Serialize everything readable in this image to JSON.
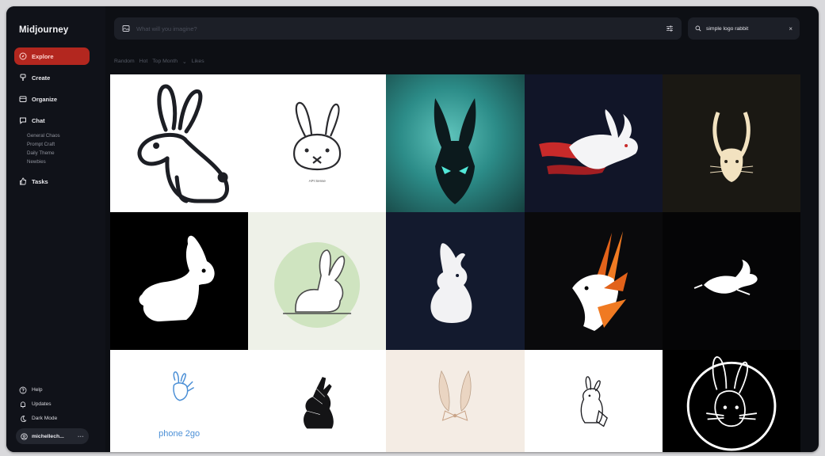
{
  "app": {
    "name": "Midjourney"
  },
  "sidebar": {
    "items": [
      {
        "label": "Explore",
        "icon": "compass-icon",
        "active": true
      },
      {
        "label": "Create",
        "icon": "brush-icon"
      },
      {
        "label": "Organize",
        "icon": "folder-icon"
      },
      {
        "label": "Chat",
        "icon": "chat-icon"
      },
      {
        "label": "Tasks",
        "icon": "thumbs-up-icon"
      }
    ],
    "chat_channels": [
      "General Chaos",
      "Prompt Craft",
      "Daily Theme",
      "Newbies"
    ],
    "bottom": [
      {
        "label": "Help",
        "icon": "help-icon"
      },
      {
        "label": "Updates",
        "icon": "bell-icon"
      },
      {
        "label": "Dark Mode",
        "icon": "moon-icon"
      }
    ],
    "user": {
      "name": "michellech...",
      "more": "···"
    }
  },
  "imagine": {
    "placeholder": "What will you imagine?"
  },
  "search": {
    "query": "simple logo rabbit",
    "clear": "×"
  },
  "filters": [
    "Random",
    "Hot",
    "Top Month",
    "Likes"
  ],
  "tiles": {
    "t2_caption": "API Sense",
    "t11_text": "phone 2go"
  },
  "colors": {
    "accent": "#b3271f",
    "background": "#0d0f14",
    "sidebar": "#101219",
    "input": "#1c1f27"
  }
}
